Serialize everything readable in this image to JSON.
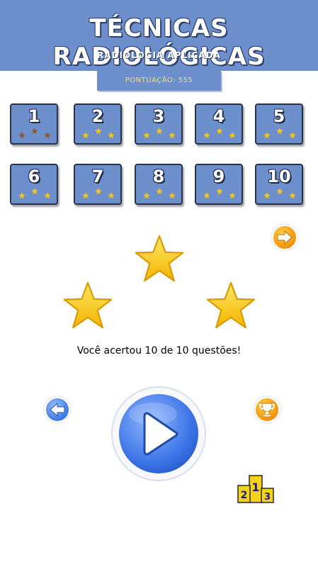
{
  "header": {
    "title": "TÉCNICAS RADIOLÓGICAS",
    "subtitle": "RADIOLOGIA APLICADA",
    "score_label": "PONTUAÇÃO: 555"
  },
  "levels": [
    {
      "number": "1",
      "stars_earned": 3,
      "star_color": "bronze"
    },
    {
      "number": "2",
      "stars_earned": 3,
      "star_color": "gold"
    },
    {
      "number": "3",
      "stars_earned": 3,
      "star_color": "gold"
    },
    {
      "number": "4",
      "stars_earned": 3,
      "star_color": "gold"
    },
    {
      "number": "5",
      "stars_earned": 3,
      "star_color": "gold"
    },
    {
      "number": "6",
      "stars_earned": 3,
      "star_color": "gold"
    },
    {
      "number": "7",
      "stars_earned": 3,
      "star_color": "gold"
    },
    {
      "number": "8",
      "stars_earned": 3,
      "star_color": "gold"
    },
    {
      "number": "9",
      "stars_earned": 3,
      "star_color": "gold"
    },
    {
      "number": "10",
      "stars_earned": 3,
      "star_color": "gold"
    }
  ],
  "result": {
    "stars": 3,
    "message": "Você acertou 10 de 10 questões!"
  },
  "icons": {
    "next": "arrow-right-icon",
    "back": "arrow-left-icon",
    "trophy": "trophy-icon",
    "play": "play-icon",
    "ranking": "podium-icon"
  },
  "colors": {
    "accent_blue": "#6d8fcc",
    "star_gold": "#f5c518",
    "star_bronze": "#8a5a2b",
    "score_text": "#f7e05a"
  }
}
